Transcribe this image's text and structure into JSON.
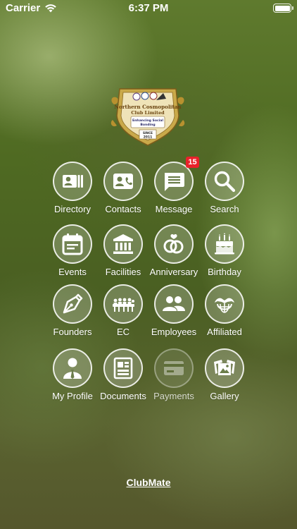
{
  "status": {
    "carrier": "Carrier",
    "time": "6:37 PM"
  },
  "logo": {
    "name_line1": "Northern Cosmopolitan",
    "name_line2": "Club Limited",
    "tagline1": "Enhancing Social",
    "tagline2": "Bonding",
    "since": "SINCE",
    "year": "2011"
  },
  "tiles": [
    {
      "label": "Directory",
      "icon": "directory-icon"
    },
    {
      "label": "Contacts",
      "icon": "contacts-icon"
    },
    {
      "label": "Message",
      "icon": "message-icon",
      "badge": "15"
    },
    {
      "label": "Search",
      "icon": "search-icon"
    },
    {
      "label": "Events",
      "icon": "calendar-icon"
    },
    {
      "label": "Facilities",
      "icon": "bank-icon"
    },
    {
      "label": "Anniversary",
      "icon": "rings-icon"
    },
    {
      "label": "Birthday",
      "icon": "cake-icon"
    },
    {
      "label": "Founders",
      "icon": "pen-nib-icon"
    },
    {
      "label": "EC",
      "icon": "meeting-icon"
    },
    {
      "label": "Employees",
      "icon": "people-icon"
    },
    {
      "label": "Affiliated",
      "icon": "globe-handshake-icon"
    },
    {
      "label": "My Profile",
      "icon": "profile-icon"
    },
    {
      "label": "Documents",
      "icon": "documents-icon"
    },
    {
      "label": "Payments",
      "icon": "card-icon"
    },
    {
      "label": "Gallery",
      "icon": "gallery-icon"
    }
  ],
  "footer": {
    "link": "ClubMate"
  },
  "colors": {
    "badge": "#e8222b",
    "accent": "#c9a94a"
  }
}
